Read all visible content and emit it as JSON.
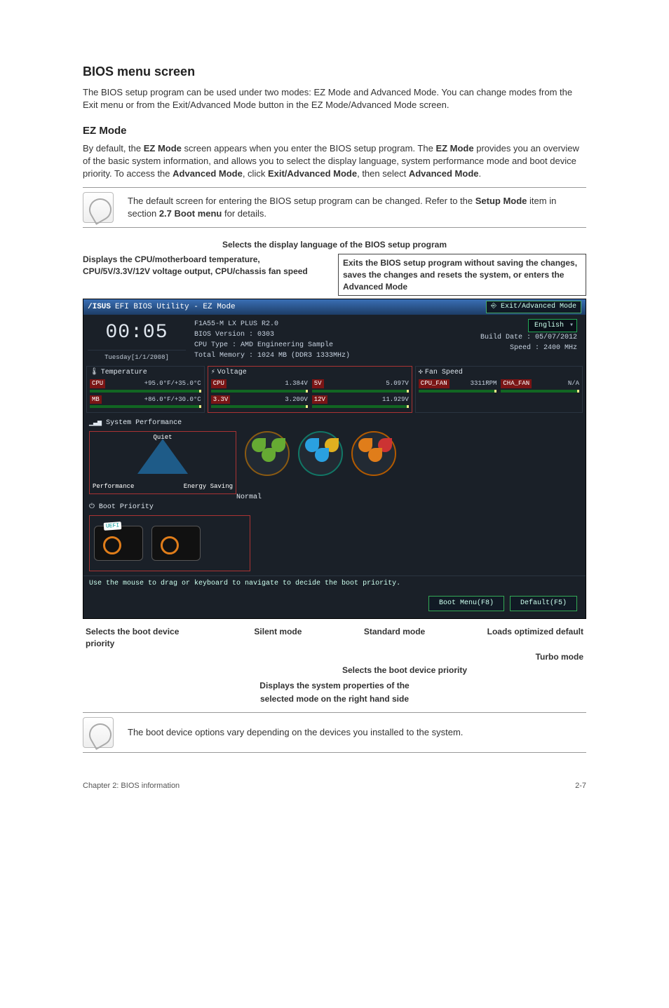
{
  "page": {
    "title": "BIOS menu screen",
    "intro": "The BIOS setup program can be used under two modes: EZ Mode and Advanced Mode. You can change modes from the Exit menu or from the Exit/Advanced Mode button in the EZ Mode/Advanced Mode screen.",
    "ez_heading": "EZ Mode",
    "ez_para_prefix": "By default, the ",
    "ez_bold1": "EZ Mode",
    "ez_para_mid1": " screen appears when you enter the BIOS setup program. The ",
    "ez_bold2": "EZ Mode",
    "ez_para_mid2": " provides you an overview of the basic system information, and allows you to select the display language, system performance mode and boot device priority. To access the ",
    "ez_bold3": "Advanced Mode",
    "ez_para_mid3": ", click ",
    "ez_bold4": "Exit/Advanced Mode",
    "ez_para_mid4": ", then select ",
    "ez_bold5": "Advanced Mode",
    "ez_para_end": "."
  },
  "note1_prefix": "The default screen for entering the BIOS setup program can be changed. Refer to the ",
  "note1_bold1": "Setup Mode",
  "note1_mid": " item in section ",
  "note1_bold2": "2.7 Boot menu",
  "note1_suffix": " for details.",
  "callouts_top": {
    "lang": "Selects the display language of the BIOS setup program",
    "left": "Displays the CPU/motherboard temperature, CPU/5V/3.3V/12V voltage output, CPU/chassis fan speed",
    "right": "Exits the BIOS setup program without saving the changes, saves the changes and resets the system, or enters the Advanced Mode"
  },
  "bios": {
    "titlebar_brand": "/ISUS",
    "titlebar_text": "EFI BIOS Utility - EZ Mode",
    "exit_btn": "Exit/Advanced Mode",
    "clock_time": "00:05",
    "clock_date": "Tuesday[1/1/2008]",
    "model": "F1A55-M LX PLUS R2.0",
    "bios_version": "BIOS Version : 0303",
    "cpu_type": "CPU Type : AMD Engineering Sample",
    "total_mem": "Total Memory : 1024 MB (DDR3 1333MHz)",
    "build_date": "Build Date : 05/07/2012",
    "speed": "Speed : 2400 MHz",
    "language": "English",
    "sensor": {
      "temp_title": "Temperature",
      "volt_title": "Voltage",
      "fan_title": "Fan Speed",
      "cpu_label": "CPU",
      "cpu_temp": "+95.0°F/+35.0°C",
      "mb_label": "MB",
      "mb_temp": "+86.0°F/+30.0°C",
      "cpu_v": "1.384V",
      "v5_label": "5V",
      "v5": "5.097V",
      "v33_label": "3.3V",
      "v33": "3.200V",
      "v12_label": "12V",
      "v12": "11.929V",
      "cpu_fan_label": "CPU_FAN",
      "cpu_fan": "3311RPM",
      "cha_fan_label": "CHA_FAN",
      "cha_fan": "N/A"
    },
    "sys_perf_title": "System Performance",
    "quiet": "Quiet",
    "performance": "Performance",
    "energy": "Energy Saving",
    "normal": "Normal",
    "boot_title": "Boot Priority",
    "uefi_badge": "UEFI",
    "hint": "Use the mouse to drag or keyboard to navigate to decide the boot priority.",
    "boot_menu_btn": "Boot Menu(F8)",
    "default_btn": "Default(F5)"
  },
  "callouts_bottom": {
    "boot_priority": "Selects the boot device priority",
    "silent": "Silent mode",
    "standard": "Standard mode",
    "loads_default": "Loads optimized default",
    "turbo": "Turbo mode",
    "sel_boot2": "Selects the boot device priority",
    "sys_props1": "Displays the system properties of the",
    "sys_props2": "selected mode on the right hand side"
  },
  "note2": "The boot device options vary depending on the devices you installed to the system.",
  "footer_left": "Chapter 2: BIOS information",
  "footer_right": "2-7"
}
